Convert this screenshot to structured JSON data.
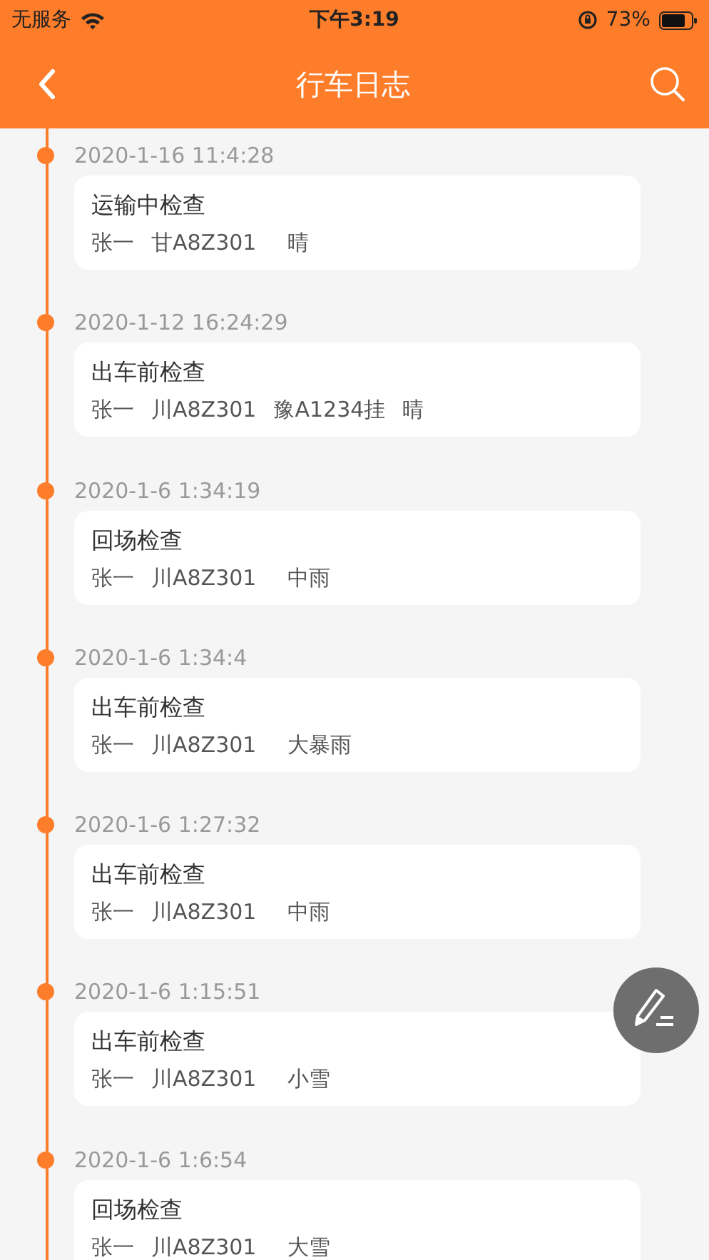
{
  "status_bar": {
    "carrier": "无服务",
    "time": "下午3:19",
    "battery": "73%"
  },
  "nav": {
    "title": "行车日志"
  },
  "entries": [
    {
      "time": "2020-1-16 11:4:28",
      "title": "运输中检查",
      "driver": "张一",
      "plate": "甘A8Z301",
      "weather": "晴"
    },
    {
      "time": "2020-1-12 16:24:29",
      "title": "出车前检查",
      "driver": "张一",
      "plate": "川A8Z301",
      "trailer": "豫A1234挂",
      "weather": "晴"
    },
    {
      "time": "2020-1-6 1:34:19",
      "title": "回场检查",
      "driver": "张一",
      "plate": "川A8Z301",
      "weather": "中雨"
    },
    {
      "time": "2020-1-6 1:34:4",
      "title": "出车前检查",
      "driver": "张一",
      "plate": "川A8Z301",
      "weather": "大暴雨"
    },
    {
      "time": "2020-1-6 1:27:32",
      "title": "出车前检查",
      "driver": "张一",
      "plate": "川A8Z301",
      "weather": "中雨"
    },
    {
      "time": "2020-1-6 1:15:51",
      "title": "出车前检查",
      "driver": "张一",
      "plate": "川A8Z301",
      "weather": "小雪"
    },
    {
      "time": "2020-1-6 1:6:54",
      "title": "回场检查",
      "driver": "张一",
      "plate": "川A8Z301",
      "weather": "大雪"
    }
  ]
}
